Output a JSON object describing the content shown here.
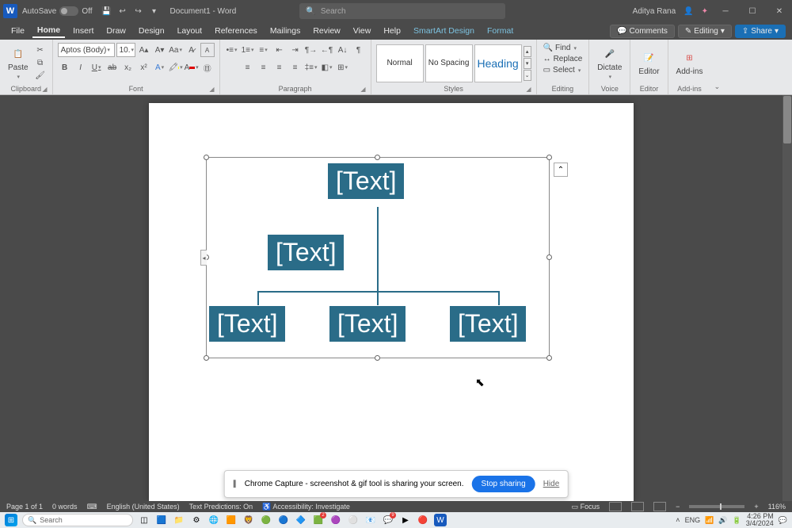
{
  "titlebar": {
    "autosave_label": "AutoSave",
    "autosave_state": "Off",
    "doc_title": "Document1 - Word",
    "search_placeholder": "Search",
    "user_name": "Aditya Rana"
  },
  "menu": {
    "tabs": [
      "File",
      "Home",
      "Insert",
      "Draw",
      "Design",
      "Layout",
      "References",
      "Mailings",
      "Review",
      "View",
      "Help",
      "SmartArt Design",
      "Format"
    ],
    "active": "Home",
    "comments": "Comments",
    "editing": "Editing",
    "share": "Share"
  },
  "ribbon": {
    "clipboard": {
      "paste": "Paste",
      "label": "Clipboard"
    },
    "font": {
      "name": "Aptos (Body)",
      "size": "10.",
      "label": "Font"
    },
    "paragraph": {
      "label": "Paragraph"
    },
    "styles": {
      "normal": "Normal",
      "nospacing": "No Spacing",
      "heading": "Heading",
      "label": "Styles"
    },
    "editing": {
      "find": "Find",
      "replace": "Replace",
      "select": "Select",
      "label": "Editing"
    },
    "voice": {
      "dictate": "Dictate",
      "label": "Voice"
    },
    "editor": {
      "editor": "Editor",
      "label": "Editor"
    },
    "addins": {
      "addins": "Add-ins",
      "label": "Add-ins"
    }
  },
  "smartart": {
    "nodes": [
      "[Text]",
      "[Text]",
      "[Text]",
      "[Text]",
      "[Text]"
    ]
  },
  "toast": {
    "msg": "Chrome Capture - screenshot & gif tool is sharing your screen.",
    "stop": "Stop sharing",
    "hide": "Hide"
  },
  "status": {
    "page": "Page 1 of 1",
    "words": "0 words",
    "lang": "English (United States)",
    "predict": "Text Predictions: On",
    "access": "Accessibility: Investigate",
    "focus": "Focus",
    "zoom": "116%"
  },
  "taskbar": {
    "search": "Search",
    "time": "4:26 PM",
    "date": "3/4/2024"
  }
}
